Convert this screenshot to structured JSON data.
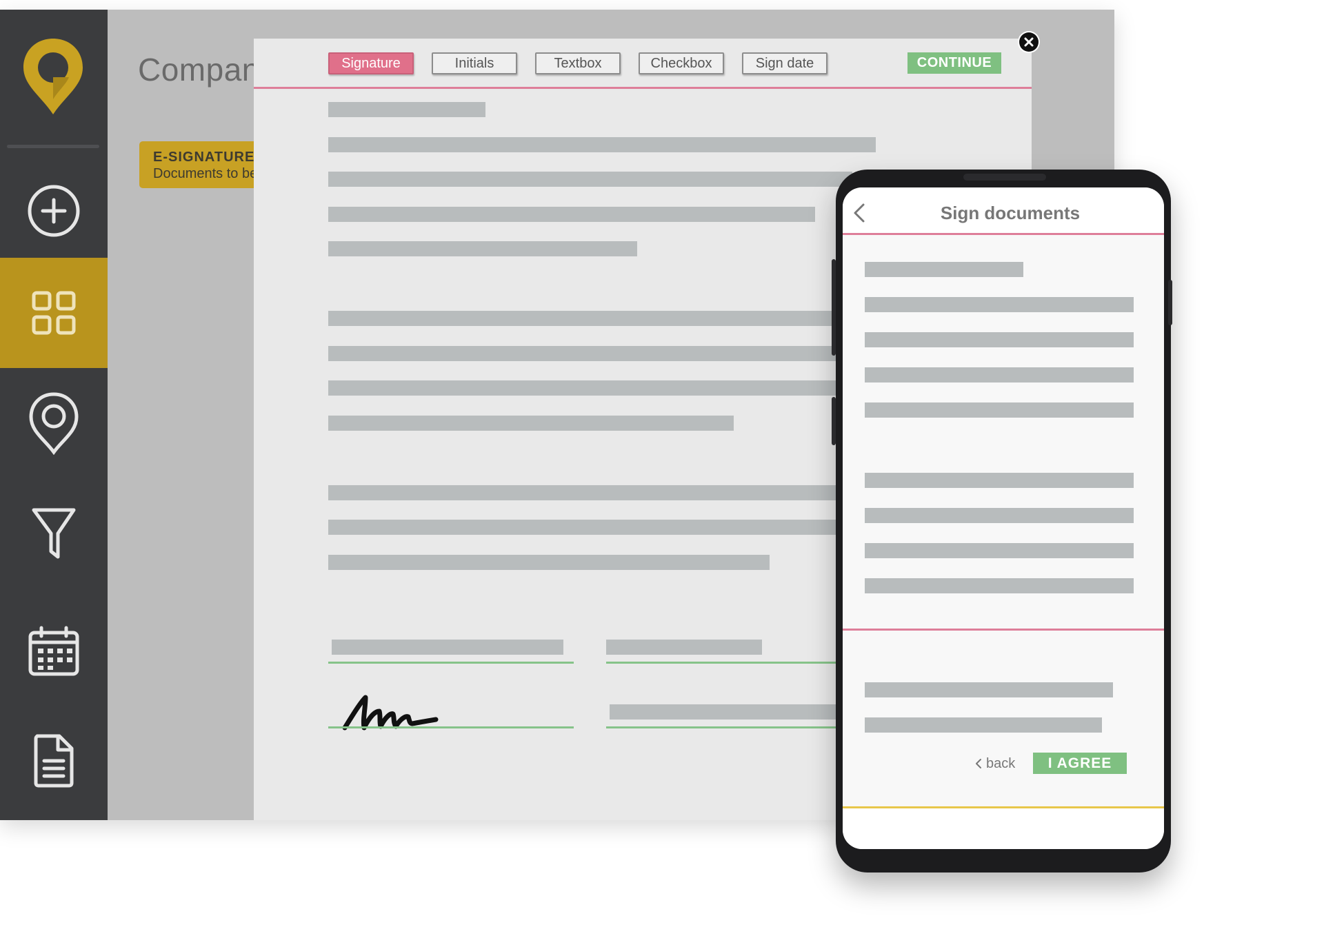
{
  "colors": {
    "sidebar": "#3b3c3e",
    "sidebar_active": "#b9941d",
    "accent_pink": "#de7e99",
    "accent_green": "#7fc081",
    "accent_yellow": "#c8a124"
  },
  "sidebar": {
    "logo_icon": "map-pin-logo-icon",
    "items": [
      {
        "icon": "plus-circle-icon",
        "active": false
      },
      {
        "icon": "grid-icon",
        "active": true
      },
      {
        "icon": "map-pin-icon",
        "active": false
      },
      {
        "icon": "funnel-icon",
        "active": false
      },
      {
        "icon": "calendar-icon",
        "active": false
      },
      {
        "icon": "document-icon",
        "active": false
      }
    ]
  },
  "page": {
    "title": "Compan",
    "badge_title": "E-SIGNATURE",
    "badge_subtitle": "Documents to be"
  },
  "toolbar": {
    "tools": [
      "Signature",
      "Initials",
      "Textbox",
      "Checkbox",
      "Sign date"
    ],
    "active_tool": "Signature",
    "continue_label": "CONTINUE",
    "close_icon": "close-icon"
  },
  "phone": {
    "title": "Sign documents",
    "back_label": "back",
    "agree_label": "I AGREE"
  }
}
